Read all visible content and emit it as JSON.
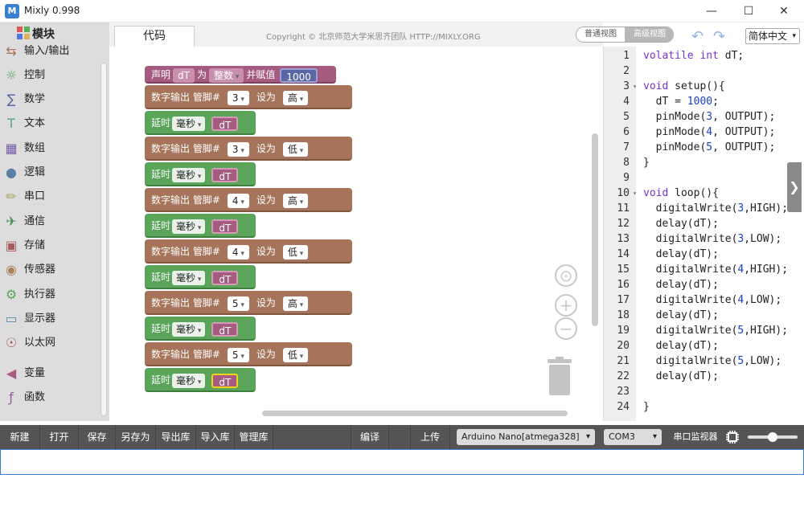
{
  "window": {
    "title": "Mixly 0.998",
    "icon_text": "M"
  },
  "toolbox": {
    "header": "模块",
    "categories": [
      {
        "label": "输入/输出",
        "icon": "arrows-icon",
        "color": "#a5745b"
      },
      {
        "label": "控制",
        "icon": "gamepad-icon",
        "color": "#5ba55b"
      },
      {
        "label": "数学",
        "icon": "math-icon",
        "color": "#5b67a5"
      },
      {
        "label": "文本",
        "icon": "text-icon",
        "color": "#5ba58c"
      },
      {
        "label": "数组",
        "icon": "array-icon",
        "color": "#745ba5"
      },
      {
        "label": "逻辑",
        "icon": "bulb-icon",
        "color": "#5b80a5"
      },
      {
        "label": "串口",
        "icon": "serial-icon",
        "color": "#a5a55b"
      },
      {
        "label": "通信",
        "icon": "comm-icon",
        "color": "#4a8f4a"
      },
      {
        "label": "存储",
        "icon": "storage-icon",
        "color": "#a55b5b"
      },
      {
        "label": "传感器",
        "icon": "sensor-icon",
        "color": "#a5845b"
      },
      {
        "label": "执行器",
        "icon": "actuator-icon",
        "color": "#5ba55b"
      },
      {
        "label": "显示器",
        "icon": "monitor-icon",
        "color": "#5b8ca5"
      },
      {
        "label": "以太网",
        "icon": "globe-icon",
        "color": "#a55b5b"
      },
      {
        "label": "变量",
        "icon": "variable-icon",
        "color": "#a55b80"
      },
      {
        "label": "函数",
        "icon": "function-icon",
        "color": "#995ba5"
      }
    ]
  },
  "tabs": {
    "code": "代码"
  },
  "copyright": "Copyright © 北京师范大学米思齐团队 HTTP://MIXLY.ORG",
  "view": {
    "normal": "普通视图",
    "advanced": "高级视图"
  },
  "language": "简体中文",
  "blocks": {
    "declare": {
      "label": "声明",
      "var": "dT",
      "as": "为",
      "type": "整数",
      "assign": "并赋值",
      "value": "1000"
    },
    "digital_label": "数字输出 管脚#",
    "set_label": "设为",
    "delay_label": "延时",
    "delay_unit": "毫秒",
    "var_name": "dT",
    "sequence": [
      {
        "kind": "digital",
        "pin": "3",
        "level": "高"
      },
      {
        "kind": "delay"
      },
      {
        "kind": "digital",
        "pin": "3",
        "level": "低"
      },
      {
        "kind": "delay"
      },
      {
        "kind": "digital",
        "pin": "4",
        "level": "高"
      },
      {
        "kind": "delay"
      },
      {
        "kind": "digital",
        "pin": "4",
        "level": "低"
      },
      {
        "kind": "delay"
      },
      {
        "kind": "digital",
        "pin": "5",
        "level": "高"
      },
      {
        "kind": "delay"
      },
      {
        "kind": "digital",
        "pin": "5",
        "level": "低"
      },
      {
        "kind": "delay",
        "selected": true
      }
    ]
  },
  "code": {
    "lines": [
      "volatile int dT;",
      "",
      "void setup(){",
      "  dT = 1000;",
      "  pinMode(3, OUTPUT);",
      "  pinMode(4, OUTPUT);",
      "  pinMode(5, OUTPUT);",
      "}",
      "",
      "void loop(){",
      "  digitalWrite(3,HIGH);",
      "  delay(dT);",
      "  digitalWrite(3,LOW);",
      "  delay(dT);",
      "  digitalWrite(4,HIGH);",
      "  delay(dT);",
      "  digitalWrite(4,LOW);",
      "  delay(dT);",
      "  digitalWrite(5,HIGH);",
      "  delay(dT);",
      "  digitalWrite(5,LOW);",
      "  delay(dT);",
      "",
      "}"
    ],
    "fold_lines": [
      3,
      10
    ],
    "keyword_color": "#7a2fd6",
    "number_color": "#1a40c8"
  },
  "toolbar": {
    "new": "新建",
    "open": "打开",
    "save": "保存",
    "save_as": "另存为",
    "export_lib": "导出库",
    "import_lib": "导入库",
    "manage_lib": "管理库",
    "compile": "编译",
    "upload": "上传",
    "board": "Arduino Nano[atmega328]",
    "port": "COM3",
    "serial_monitor": "串口监视器"
  }
}
